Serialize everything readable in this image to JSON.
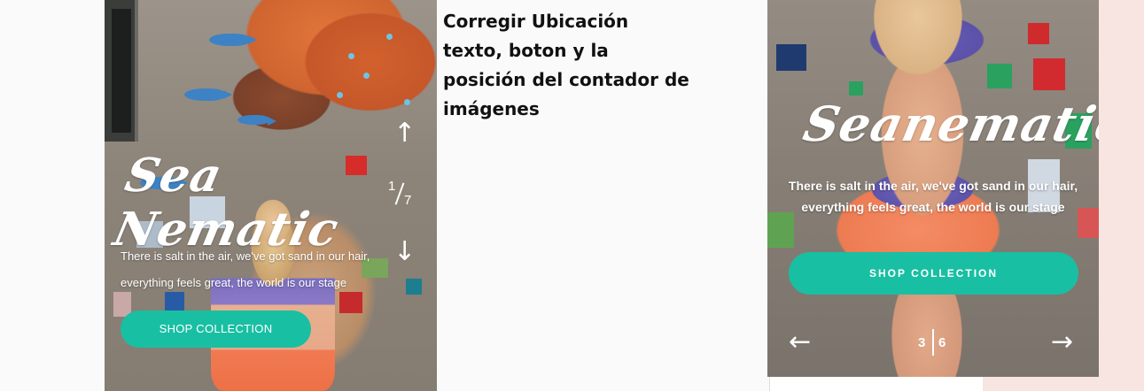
{
  "colors": {
    "accent_button": "#19bfa3",
    "text_light": "#ffffff",
    "annotation_text": "#111111",
    "page_background": "#fafafa",
    "right_strip": "#f8e5e1"
  },
  "left_mockup": {
    "title": "Sea Nematic",
    "counter": {
      "current": "1",
      "total": "7"
    },
    "arrow_up_icon": "arrow-up",
    "arrow_down_icon": "arrow-down",
    "description": "There is salt in the air, we've got sand in our hair, everything feels great, the world is our stage",
    "button_label": "SHOP COLLECTION"
  },
  "annotation": {
    "lines": [
      "Corregir Ubicación",
      "texto, boton y la",
      "posición del contador de",
      "imágenes"
    ]
  },
  "right_mockup": {
    "title": "Seanematic",
    "description": "There is salt in the air, we've got sand in our hair, everything feels great, the world is our stage",
    "button_label": "SHOP COLLECTION",
    "counter": {
      "current": "3",
      "total": "6"
    },
    "arrow_left_icon": "arrow-left",
    "arrow_right_icon": "arrow-right"
  }
}
